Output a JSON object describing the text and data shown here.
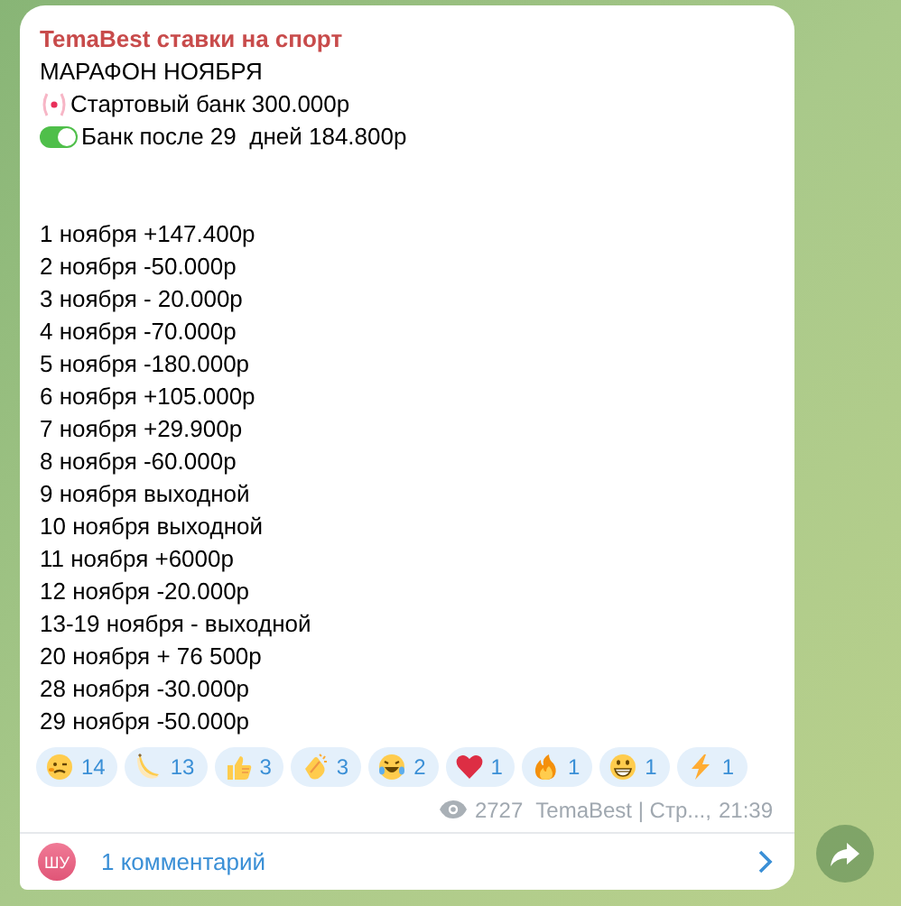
{
  "post": {
    "channel": "TemaBest ставки на спорт",
    "heading": "МАРАФОН НОЯБРЯ",
    "status_lines": [
      {
        "kind": "radio",
        "text": "Стартовый банк 300.000р"
      },
      {
        "kind": "toggle",
        "text": "Банк после 29  дней 184.800р"
      }
    ],
    "days": [
      "1 ноября +147.400р",
      "2 ноября -50.000р",
      "3 ноября - 20.000р",
      "4 ноября -70.000р",
      "5 ноября -180.000р",
      "6 ноября +105.000р",
      "7 ноября +29.900р",
      "8 ноября -60.000р",
      "9 ноября выходной",
      "10 ноября выходной",
      "11 ноября +6000р",
      "12 ноября -20.000р",
      "13-19 ноября - выходной",
      "20 ноября + 76 500р",
      "28 ноября -30.000р",
      "29 ноября -50.000р"
    ],
    "reactions": [
      {
        "kind": "woozy",
        "count": "14"
      },
      {
        "kind": "banana",
        "count": "13"
      },
      {
        "kind": "thumbs",
        "count": "3"
      },
      {
        "kind": "clap",
        "count": "3"
      },
      {
        "kind": "laugh",
        "count": "2"
      },
      {
        "kind": "heart",
        "count": "1"
      },
      {
        "kind": "fire",
        "count": "1"
      },
      {
        "kind": "grin",
        "count": "1"
      },
      {
        "kind": "bolt",
        "count": "1"
      }
    ],
    "views": "2727",
    "signature": "TemaBest | Стр...,",
    "time": "21:39",
    "comments": {
      "avatar": "ШУ",
      "label": "1 комментарий"
    }
  }
}
